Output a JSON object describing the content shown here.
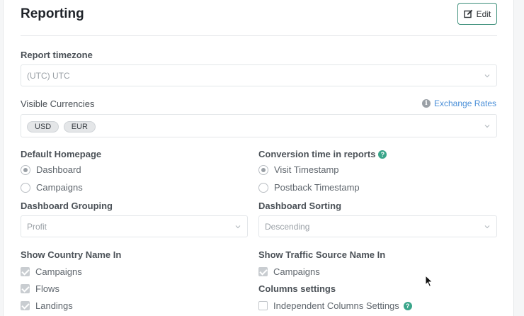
{
  "header": {
    "title": "Reporting",
    "edit_label": "Edit"
  },
  "report_timezone": {
    "label": "Report timezone",
    "value": "(UTC) UTC"
  },
  "visible_currencies": {
    "label": "Visible Currencies",
    "tags": [
      "USD",
      "EUR"
    ],
    "exchange_rates_link": "Exchange Rates"
  },
  "default_homepage": {
    "label": "Default Homepage",
    "options": [
      {
        "label": "Dashboard",
        "selected": true
      },
      {
        "label": "Campaigns",
        "selected": false
      }
    ]
  },
  "conversion_time": {
    "label": "Conversion time in reports",
    "options": [
      {
        "label": "Visit Timestamp",
        "selected": true
      },
      {
        "label": "Postback Timestamp",
        "selected": false
      }
    ]
  },
  "dashboard_grouping": {
    "label": "Dashboard Grouping",
    "value": "Profit"
  },
  "dashboard_sorting": {
    "label": "Dashboard Sorting",
    "value": "Descending"
  },
  "show_country_name": {
    "label": "Show Country Name In",
    "options": [
      {
        "label": "Campaigns",
        "checked": true
      },
      {
        "label": "Flows",
        "checked": true
      },
      {
        "label": "Landings",
        "checked": true
      }
    ]
  },
  "show_traffic_source": {
    "label": "Show Traffic Source Name In",
    "options": [
      {
        "label": "Campaigns",
        "checked": true
      }
    ]
  },
  "columns_settings": {
    "label": "Columns settings",
    "options": [
      {
        "label": "Independent Columns Settings",
        "checked": false
      }
    ]
  },
  "colors": {
    "accent": "#3aa58a",
    "link": "#4a8fd8"
  }
}
